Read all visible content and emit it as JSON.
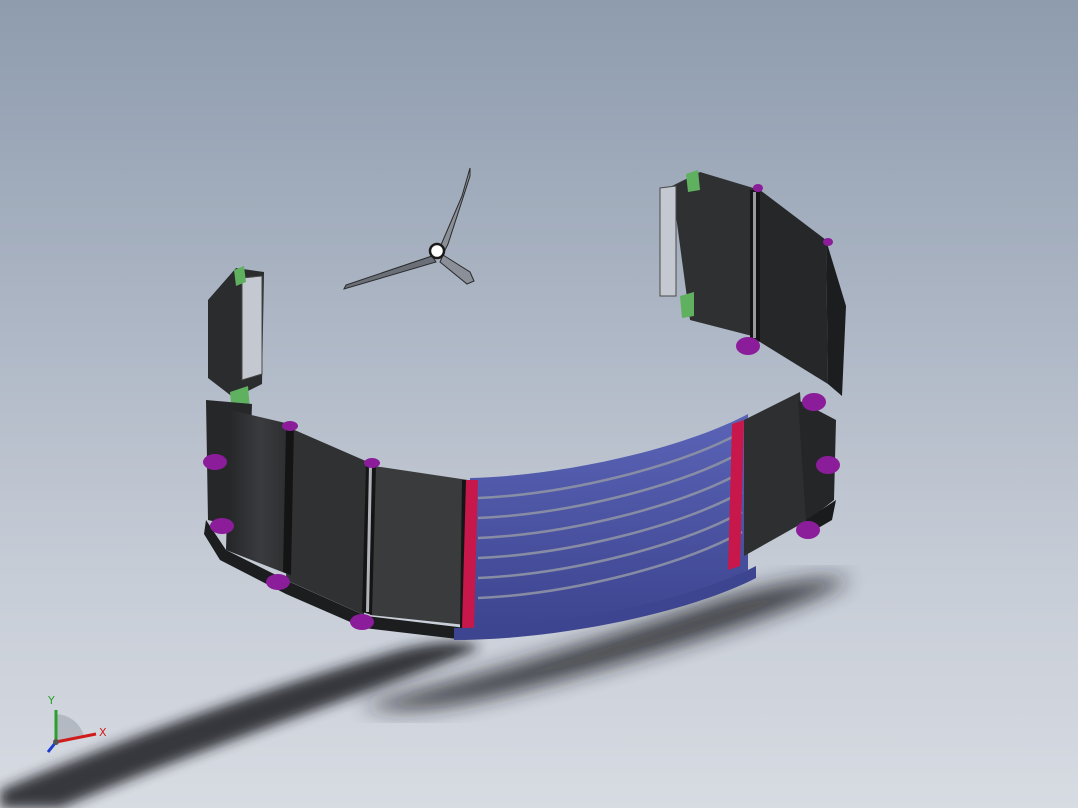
{
  "viewport": {
    "background_top": "#8e9cae",
    "background_bottom": "#d7dbe2"
  },
  "model": {
    "segment_color": "#2e2f31",
    "screen_color": "#4e57a6",
    "accent_red": "#c8174a",
    "pin_color": "#8b1d9b",
    "clip_color": "#4aa04a"
  },
  "watch_hands": {
    "icon": "watch-hands-icon"
  },
  "triad": {
    "x_label": "X",
    "y_label": "Y",
    "x_color": "#d11b1b",
    "y_color": "#2aa02a",
    "z_color": "#1b3ad1"
  }
}
